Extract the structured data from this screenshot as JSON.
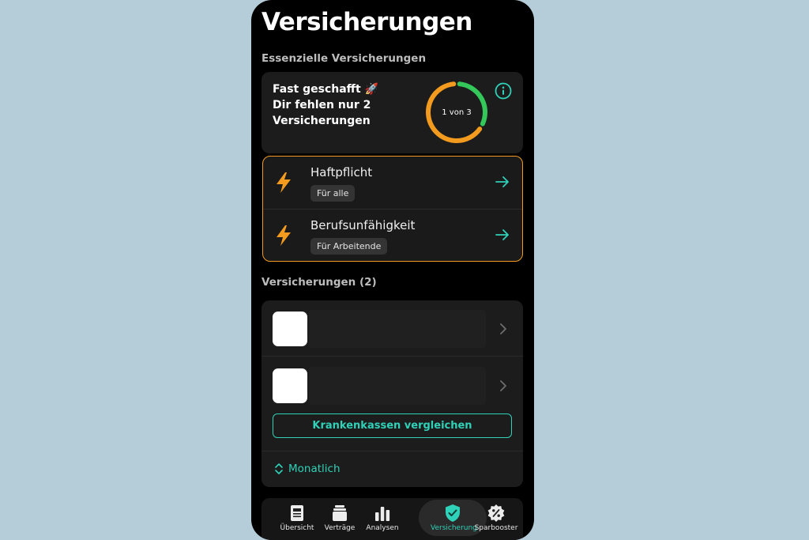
{
  "page": {
    "title": "Versicherungen"
  },
  "essentials": {
    "section_label": "Essenzielle Versicherungen",
    "progress_line1": "Fast geschafft 🚀",
    "progress_line2": "Dir fehlen nur 2",
    "progress_line3": "Versicherungen",
    "ring_label": "1 von 3",
    "ring_progress": 0.333,
    "items": [
      {
        "name": "Haftpflicht",
        "tag": "Für alle"
      },
      {
        "name": "Berufsunfähigkeit",
        "tag": "Für Arbeitende"
      }
    ]
  },
  "insurances": {
    "section_label": "Versicherungen (2)",
    "compare_button": "Krankenkassen vergleichen",
    "period_label": "Monatlich"
  },
  "nav": {
    "items": [
      {
        "label": "Übersicht",
        "icon": "overview-icon"
      },
      {
        "label": "Verträge",
        "icon": "contracts-icon"
      },
      {
        "label": "Analysen",
        "icon": "analytics-icon"
      },
      {
        "label": "Versicherung",
        "icon": "shield-check-icon"
      },
      {
        "label": "Sparbooster",
        "icon": "percent-badge-icon"
      }
    ],
    "active_index": 3
  },
  "colors": {
    "accent": "#2fd1b8",
    "warning": "#f29b1f",
    "success": "#34c759",
    "background": "#b5cdd8"
  }
}
